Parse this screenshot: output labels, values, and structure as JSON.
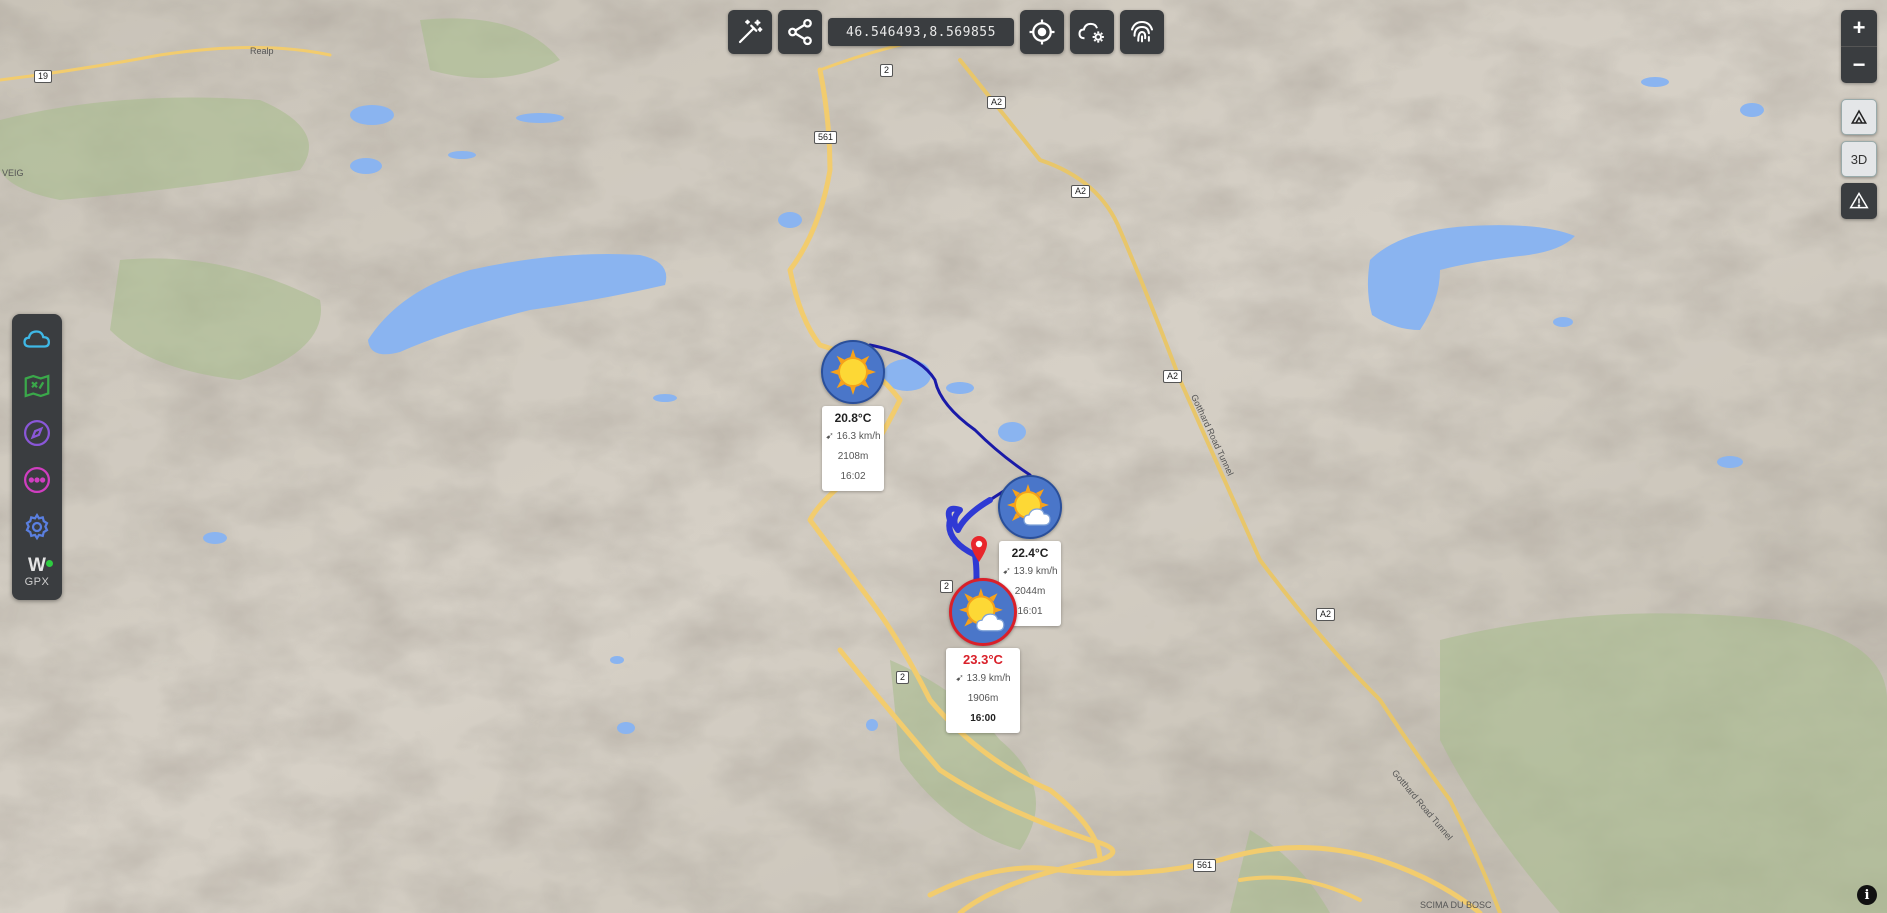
{
  "toolbar": {
    "coordinates": "46.546493,8.569855",
    "buttons": [
      {
        "icon": "magic-wand-icon"
      },
      {
        "icon": "share-icon"
      },
      {
        "icon": "locate-icon"
      },
      {
        "icon": "cloud-settings-icon"
      },
      {
        "icon": "fingerprint-icon"
      }
    ]
  },
  "map_controls": {
    "zoom_in": "+",
    "zoom_out": "−",
    "terrain_icon": "mountain-icon",
    "view_mode": "3D",
    "warning_icon": "warning-icon"
  },
  "sidebar": {
    "items": [
      {
        "icon": "cloud-icon",
        "color": "#3fb8e6"
      },
      {
        "icon": "map-route-icon",
        "color": "#3aa84a"
      },
      {
        "icon": "compass-icon",
        "color": "#8a57d8"
      },
      {
        "icon": "more-icon",
        "color": "#d03ec0"
      },
      {
        "icon": "gear-icon",
        "color": "#5a7fe0"
      }
    ],
    "gpx_logo": "W",
    "gpx_label": "GPX",
    "status_color": "#2ecc40"
  },
  "waypoints": [
    {
      "temp": "20.8°C",
      "wind": "16.3 km/h",
      "elevation": "2108m",
      "time": "16:02",
      "icon": "sun-icon",
      "active": false
    },
    {
      "temp": "22.4°C",
      "wind": "13.9 km/h",
      "elevation": "2044m",
      "time": "16:01",
      "icon": "sun-cloud-icon",
      "active": false
    },
    {
      "temp": "23.3°C",
      "wind": "13.9 km/h",
      "elevation": "1906m",
      "time": "16:00",
      "icon": "sun-cloud-icon",
      "active": true
    }
  ],
  "route_color": "#1a1aa8",
  "active_color": "#d9202a",
  "map_labels": {
    "places": [
      "Realp",
      "VEIG",
      "Gotthard Road Tunnel",
      "Gotthard Road Tunnel",
      "SCIMA DU BOSC"
    ],
    "roads": [
      "19",
      "2",
      "A2",
      "561",
      "A2",
      "A2",
      "A2",
      "2",
      "561",
      "2"
    ]
  },
  "attribution": "i"
}
